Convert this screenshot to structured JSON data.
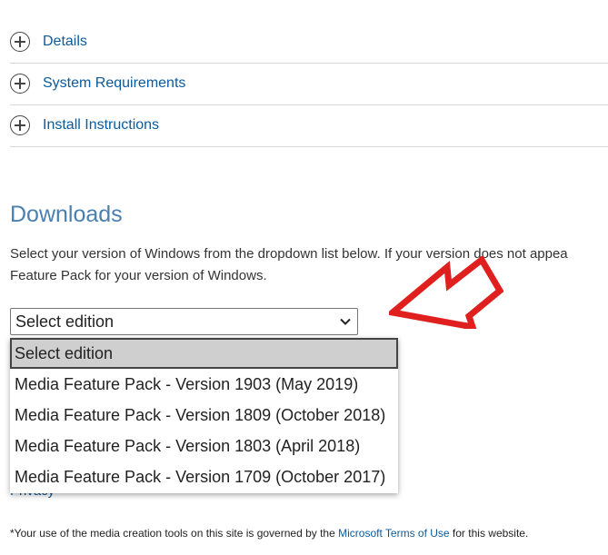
{
  "accordion": {
    "items": [
      {
        "label": "Details"
      },
      {
        "label": "System Requirements"
      },
      {
        "label": "Install Instructions"
      }
    ]
  },
  "downloads": {
    "title": "Downloads",
    "intro_line1": "Select your version of Windows from the dropdown list below. If your version does not appea",
    "intro_line2": "Feature Pack for your version of Windows."
  },
  "edition_select": {
    "value": "Select edition",
    "options": [
      {
        "label": "Select edition",
        "selected": true
      },
      {
        "label": "Media Feature Pack - Version 1903 (May 2019)"
      },
      {
        "label": "Media Feature Pack - Version 1809 (October 2018)"
      },
      {
        "label": "Media Feature Pack - Version 1803 (April 2018)"
      },
      {
        "label": "Media Feature Pack - Version 1709 (October 2017)"
      }
    ]
  },
  "privacy_link": "Privacy",
  "footer": {
    "prefix": "*Your use of the media creation tools on this site is governed by the ",
    "link": "Microsoft Terms of Use",
    "suffix": " for this website."
  },
  "colors": {
    "link": "#0a5a9c",
    "heading": "#4a7fb0",
    "annotation_arrow": "#e0201e"
  }
}
